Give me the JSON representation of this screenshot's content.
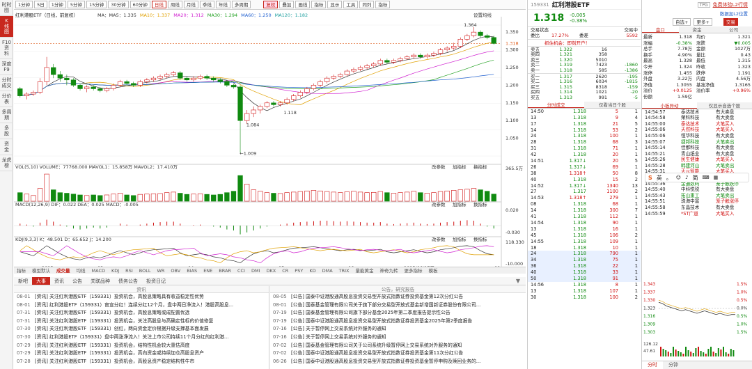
{
  "leftbar": [
    "时时\n图",
    "K\n线\n图",
    "F10\n资\n料",
    "深度\nF9",
    "分时\n成交",
    "分价\n表",
    "多周\n期",
    "多\n股",
    "资\n金",
    "龙虎\n榜"
  ],
  "toolbar": {
    "periods": [
      "1分钟",
      "5日",
      "1分钟",
      "5分钟",
      "15分钟",
      "30分钟",
      "60分钟",
      "日线",
      "周线",
      "月线",
      "季线",
      "年线",
      "多周期"
    ],
    "selected": "日线",
    "tools": [
      "复权",
      "叠加",
      "画线",
      "指标",
      "显示",
      "工具",
      "同列",
      "指标"
    ]
  },
  "chart": {
    "title": "红利港股ETF（日线，前复权）",
    "ma": [
      "MA：MA5：1.335",
      "MA10：1.337",
      "MA20：1.312",
      "MA30：1.294",
      "MA60：1.250",
      "MA120：1.182"
    ],
    "settings": "设置均线",
    "high_label": "1.364",
    "low_label": "1.009",
    "mid_label": "1.084",
    "bottom_label": "1.118",
    "price_ticks": [
      "1.350",
      "1.318",
      "1.300",
      "1.250",
      "1.200",
      "1.150",
      "1.100",
      "1.050"
    ],
    "vol_legend": "VOL(5,10)  VOLUME：77768.000  MAVOL1：15.858万  MAVOL2：17.410万",
    "vol_ticks": [
      "365.5万"
    ],
    "macd_legend": "MACD(12,26,9)  DIF：0.022  DEA：0.025  MACD：-0.005",
    "macd_ticks": [
      "0.020",
      "-0.030"
    ],
    "kdj_legend": "KDJ(9,3,3)  K：48.501  D：65.652  J：14.200",
    "kdj_ticks": [
      "118.330",
      "-10.000"
    ],
    "panel_tools": [
      "改参数",
      "加指标",
      "换指标"
    ],
    "date_labels": [
      "2025",
      "03",
      "04",
      "05",
      "06",
      "2025/06/17三",
      "08"
    ],
    "close_price": 1.318,
    "candles": [
      [
        1.19,
        1.17,
        1.195,
        1.165
      ],
      [
        1.17,
        1.175,
        1.18,
        1.16
      ],
      [
        1.175,
        1.18,
        1.185,
        1.17
      ],
      [
        1.18,
        1.21,
        1.22,
        1.175
      ],
      [
        1.21,
        1.25,
        1.28,
        1.2
      ],
      [
        1.25,
        1.23,
        1.26,
        1.22
      ],
      [
        1.23,
        1.22,
        1.24,
        1.21
      ],
      [
        1.22,
        1.215,
        1.23,
        1.2
      ],
      [
        1.215,
        1.2,
        1.22,
        1.195
      ],
      [
        1.2,
        1.19,
        1.205,
        1.185
      ],
      [
        1.19,
        1.195,
        1.2,
        1.18
      ],
      [
        1.195,
        1.19,
        1.2,
        1.185
      ],
      [
        1.19,
        1.185,
        1.195,
        1.18
      ],
      [
        1.185,
        1.19,
        1.195,
        1.18
      ],
      [
        1.19,
        1.2,
        1.205,
        1.185
      ],
      [
        1.2,
        1.21,
        1.215,
        1.195
      ],
      [
        1.21,
        1.205,
        1.215,
        1.2
      ],
      [
        1.205,
        1.2,
        1.21,
        1.195
      ],
      [
        1.2,
        1.21,
        1.215,
        1.195
      ],
      [
        1.21,
        1.215,
        1.22,
        1.205
      ],
      [
        1.215,
        1.22,
        1.225,
        1.21
      ],
      [
        1.22,
        1.225,
        1.23,
        1.215
      ],
      [
        1.225,
        1.23,
        1.235,
        1.22
      ],
      [
        1.23,
        1.235,
        1.24,
        1.225
      ],
      [
        1.235,
        1.22,
        1.24,
        1.215
      ],
      [
        1.22,
        1.215,
        1.225,
        1.21
      ],
      [
        1.215,
        1.22,
        1.225,
        1.21
      ],
      [
        1.22,
        1.225,
        1.23,
        1.215
      ],
      [
        1.225,
        1.22,
        1.23,
        1.215
      ],
      [
        1.22,
        1.215,
        1.225,
        1.21
      ],
      [
        1.215,
        1.21,
        1.22,
        1.205
      ],
      [
        1.21,
        1.2,
        1.215,
        1.195
      ],
      [
        1.2,
        1.195,
        1.205,
        1.19
      ],
      [
        1.195,
        1.1,
        1.2,
        1.009
      ],
      [
        1.1,
        1.12,
        1.13,
        1.09
      ],
      [
        1.12,
        1.13,
        1.14,
        1.11
      ],
      [
        1.13,
        1.14,
        1.145,
        1.12
      ],
      [
        1.14,
        1.15,
        1.155,
        1.135
      ],
      [
        1.15,
        1.145,
        1.155,
        1.14
      ],
      [
        1.145,
        1.15,
        1.155,
        1.14
      ],
      [
        1.15,
        1.16,
        1.165,
        1.145
      ],
      [
        1.16,
        1.17,
        1.175,
        1.155
      ],
      [
        1.17,
        1.18,
        1.185,
        1.165
      ],
      [
        1.18,
        1.19,
        1.195,
        1.175
      ],
      [
        1.19,
        1.2,
        1.205,
        1.185
      ],
      [
        1.2,
        1.21,
        1.215,
        1.195
      ],
      [
        1.21,
        1.22,
        1.225,
        1.205
      ],
      [
        1.22,
        1.225,
        1.23,
        1.215
      ],
      [
        1.225,
        1.23,
        1.235,
        1.22
      ],
      [
        1.23,
        1.24,
        1.245,
        1.225
      ],
      [
        1.24,
        1.245,
        1.25,
        1.235
      ],
      [
        1.245,
        1.25,
        1.255,
        1.24
      ],
      [
        1.25,
        1.255,
        1.26,
        1.245
      ],
      [
        1.255,
        1.26,
        1.265,
        1.25
      ],
      [
        1.26,
        1.27,
        1.275,
        1.255
      ],
      [
        1.27,
        1.265,
        1.275,
        1.26
      ],
      [
        1.265,
        1.27,
        1.275,
        1.26
      ],
      [
        1.27,
        1.275,
        1.28,
        1.265
      ],
      [
        1.275,
        1.28,
        1.285,
        1.27
      ],
      [
        1.28,
        1.285,
        1.29,
        1.275
      ],
      [
        1.285,
        1.28,
        1.29,
        1.275
      ],
      [
        1.28,
        1.285,
        1.29,
        1.275
      ],
      [
        1.285,
        1.29,
        1.295,
        1.28
      ],
      [
        1.29,
        1.3,
        1.305,
        1.285
      ],
      [
        1.3,
        1.305,
        1.31,
        1.295
      ],
      [
        1.305,
        1.31,
        1.32,
        1.3
      ],
      [
        1.31,
        1.33,
        1.335,
        1.305
      ],
      [
        1.33,
        1.34,
        1.345,
        1.325
      ],
      [
        1.34,
        1.35,
        1.364,
        1.335
      ],
      [
        1.35,
        1.34,
        1.355,
        1.335
      ],
      [
        1.34,
        1.335,
        1.345,
        1.33
      ],
      [
        1.335,
        1.318,
        1.34,
        1.315
      ]
    ],
    "volumes": [
      0.3,
      0.25,
      0.2,
      0.45,
      0.95,
      0.4,
      0.3,
      0.28,
      0.25,
      0.22,
      0.2,
      0.22,
      0.2,
      0.22,
      0.25,
      0.28,
      0.22,
      0.2,
      0.24,
      0.25,
      0.26,
      0.27,
      0.3,
      0.32,
      0.28,
      0.24,
      0.25,
      0.26,
      0.24,
      0.22,
      0.24,
      0.3,
      0.35,
      0.9,
      0.6,
      0.4,
      0.35,
      0.3,
      0.28,
      0.27,
      0.3,
      0.32,
      0.34,
      0.36,
      0.38,
      0.36,
      0.34,
      0.32,
      0.3,
      0.33,
      0.35,
      0.32,
      0.3,
      0.31,
      0.34,
      0.3,
      0.28,
      0.3,
      0.32,
      0.35,
      0.3,
      0.28,
      0.3,
      0.34,
      0.36,
      0.38,
      0.4,
      0.42,
      0.45,
      0.4,
      0.35,
      0.25
    ],
    "macd": [
      0.2,
      0.1,
      -0.1,
      0.3,
      0.6,
      0.4,
      0.1,
      -0.1,
      -0.3,
      -0.4,
      -0.3,
      -0.2,
      -0.3,
      -0.2,
      0,
      0.2,
      0.1,
      0,
      0.1,
      0.2,
      0.3,
      0.35,
      0.4,
      0.4,
      0.2,
      0,
      0.05,
      0.1,
      0,
      -0.1,
      -0.2,
      -0.4,
      -0.5,
      -0.9,
      -0.7,
      -0.5,
      -0.3,
      -0.1,
      0,
      0.1,
      0.2,
      0.3,
      0.35,
      0.4,
      0.45,
      0.5,
      0.5,
      0.45,
      0.4,
      0.45,
      0.4,
      0.35,
      0.3,
      0.3,
      0.35,
      0.2,
      0.15,
      0.2,
      0.25,
      0.3,
      0.2,
      0.15,
      0.2,
      0.3,
      0.35,
      0.4,
      0.5,
      0.55,
      0.5,
      0.2,
      -0.1,
      -0.3
    ],
    "kdj": [
      60,
      50,
      40,
      65,
      90,
      70,
      50,
      35,
      25,
      20,
      30,
      35,
      30,
      40,
      55,
      65,
      55,
      45,
      55,
      65,
      70,
      72,
      75,
      78,
      55,
      40,
      45,
      50,
      45,
      35,
      30,
      20,
      15,
      5,
      30,
      50,
      60,
      65,
      55,
      60,
      70,
      78,
      80,
      82,
      85,
      80,
      75,
      70,
      65,
      70,
      72,
      68,
      65,
      68,
      72,
      60,
      55,
      60,
      65,
      70,
      62,
      55,
      60,
      70,
      75,
      80,
      88,
      90,
      85,
      65,
      50,
      45
    ]
  },
  "bottom_tabs": [
    "指标",
    "模型默认",
    "成交量",
    "均线",
    "MACD",
    "KDJ",
    "RSI",
    "BOLL",
    "WR",
    "OBV",
    "BIAS",
    "ENE",
    "BRAR",
    "CCI",
    "DMI",
    "DKX",
    "CR",
    "PSY",
    "KD",
    "DMA",
    "TRIX",
    "量能黄金",
    "神奇九转",
    "更多指标",
    "模板"
  ],
  "news_tabs": [
    "新吧",
    "大事",
    "资讯",
    "公告",
    "关联品种",
    "债务公告",
    "投资日记"
  ],
  "news_left_header": "资讯",
  "news_left": [
    [
      "08-01",
      "[资讯] 关注红利港股ETF（159331）投资机会，高股息策略具有收益稳定性优势"
    ],
    [
      "08-01",
      "[资讯] 红利港股ETF（159331）官宣分红！连续分红12个月，盘中两日净流入！港股高股息..."
    ],
    [
      "07-31",
      "[资讯] 关注红利港股ETF（159331）投资机会，高股息策略或成配置优选"
    ],
    [
      "07-31",
      "[资讯] 关注红利港股ETF（159331）投资机会，关注高股息与高确定性标的价值修复"
    ],
    [
      "07-30",
      "[资讯] 关注红利港股ETF（159331）创红，两向资金定价根据升级支撑基本面发展"
    ],
    [
      "07-30",
      "[资讯] 红利港股ETF（159331）盘中两涨净流入！关注上市公司持续11个月分红的红利港..."
    ],
    [
      "07-29",
      "[资讯] 关注红利港股ETF（159331）投资机会，结构性机会较大重估高度"
    ],
    [
      "07-29",
      "[资讯] 关注红利港股ETF（159331）投资机会，高向资金或持续加仓高股息资产"
    ],
    [
      "07-28",
      "[资讯] 关注红利港股ETF（159331）投资机会，高股息资产稳定结构性牛市"
    ]
  ],
  "news_right_header": "公告，研究报告",
  "news_right": [
    [
      "08-05",
      "[公告] 国泰中证港股通高股息投资交易型开放式指数证券投资基金第12次分红公告"
    ],
    [
      "08-01",
      "[公告] 国泰基金管理有限公司关于旗下部分交易型开放式基金新增国新证券股份有限公司..."
    ],
    [
      "07-19",
      "[公告] 国泰基金管理有限公司旗下部分基金2025年第二季度报告提示性公告"
    ],
    [
      "07-19",
      "[公告] 国泰中证港股通高股息投资交易型开放式指数证券投资基金2025年第2季度报告"
    ],
    [
      "07-16",
      "[公告] 关于暂停网上交易系统对外服务的通知"
    ],
    [
      "07-16",
      "[公告] 关于暂停网上交易系统对外服务的通知"
    ],
    [
      "07-02",
      "[公告] 国泰基金管理有限公司关于公司系统升级暂停网上交易系统对外服务的通知"
    ],
    [
      "07-02",
      "[公告] 国泰中证港股通高股息投资交易型开放式指数证券投资基金第11次分红公告"
    ],
    [
      "06-26",
      "[公告] 国泰中证港股通高股息投资交易型开放式指数证券投资基金暂停申购及赎回业务的..."
    ]
  ],
  "quote": {
    "code": "159331",
    "name": "红利港股ETF",
    "price": "1.318",
    "change": "-0.005",
    "pct": "-0.38%",
    "buttons": [
      "自选+",
      "更多+"
    ],
    "trade": "交易",
    "top_link": "免费体验L2行情",
    "top_link2": "数据加L2位置",
    "tags": [
      "TPG"
    ]
  },
  "order": {
    "header_left": "交易状态",
    "header_right": "交易中",
    "ratio_label": "委比",
    "ratio": "17.27%",
    "diff_label": "委差",
    "diff": "5592",
    "promo": "抓住机会：即刻开户！",
    "asks": [
      [
        "卖五",
        "1.322",
        "16",
        ""
      ],
      [
        "卖四",
        "1.321",
        "358",
        ""
      ],
      [
        "卖三",
        "1.320",
        "5010",
        ""
      ],
      [
        "卖二",
        "1.319",
        "7423",
        "-1860"
      ],
      [
        "卖一",
        "1.318",
        "585",
        "-1386"
      ]
    ],
    "bids": [
      [
        "买一",
        "1.317",
        "2620",
        "-195"
      ],
      [
        "买二",
        "1.316",
        "6034",
        "-1815"
      ],
      [
        "买三",
        "1.315",
        "8318",
        "-159"
      ],
      [
        "买四",
        "1.314",
        "1021",
        "-20"
      ],
      [
        "买五",
        "1.313",
        "991",
        "-5"
      ]
    ]
  },
  "stats_tabs": [
    "盘口",
    "资金",
    "公司"
  ],
  "stats": [
    [
      "最新",
      "1.318",
      "均价",
      "1.321"
    ],
    [
      "涨幅",
      "-0.38%",
      "涨跌",
      "▼0.005"
    ],
    [
      "总手",
      "7.78万",
      "金额",
      "1027万"
    ],
    [
      "换手",
      "4.90%",
      "量比",
      "0.43"
    ],
    [
      "最高",
      "1.328",
      "最低",
      "1.315"
    ],
    [
      "今开",
      "1.324",
      "昨收",
      "1.323"
    ],
    [
      "涨停",
      "1.455",
      "跌停",
      "1.191"
    ],
    [
      "外盘",
      "3.22万",
      "内盘",
      "4.56万"
    ],
    [
      "净值",
      "1.3055",
      "基准净值",
      "1.3165"
    ],
    [
      "溢价",
      "+0.0125",
      "溢价率",
      "+0.96%"
    ],
    [
      "份额",
      "1.59亿",
      "",
      ""
    ]
  ],
  "tick_tabs": [
    "分时成交",
    "仅看当日个股"
  ],
  "ticks": [
    [
      "14:50",
      "1.318",
      "5",
      "1"
    ],
    [
      "13",
      "1.318",
      "9",
      "4"
    ],
    [
      "17",
      "1.318",
      "21",
      "5"
    ],
    [
      "14",
      "1.318",
      "53",
      "2"
    ],
    [
      "24",
      "1.318",
      "100",
      "1"
    ],
    [
      "28",
      "1.318",
      "68",
      "3"
    ],
    [
      "31",
      "1.318",
      "71",
      "1"
    ],
    [
      "42",
      "1.318",
      "20",
      "1"
    ],
    [
      "14:51",
      "1.317↓",
      "20",
      "5"
    ],
    [
      "26",
      "1.317↓",
      "69",
      "1"
    ],
    [
      "38",
      "1.318↑",
      "50",
      "8"
    ],
    [
      "40",
      "1.318",
      "15",
      "2"
    ],
    [
      "14:52",
      "1.317↓",
      "1340",
      "13"
    ],
    [
      "27",
      "1.317",
      "1100",
      "2"
    ],
    [
      "14:53",
      "1.318↑",
      "279",
      "1"
    ],
    [
      "08",
      "1.318",
      "68",
      "1"
    ],
    [
      "14",
      "1.318",
      "300",
      "7"
    ],
    [
      "41",
      "1.318",
      "112",
      "1"
    ],
    [
      "14:54",
      "1.318",
      "90",
      "1"
    ],
    [
      "13",
      "1.318",
      "16",
      "1"
    ],
    [
      "45",
      "1.318",
      "106",
      "2"
    ],
    [
      "14:55",
      "1.318",
      "109",
      "1"
    ],
    [
      "18",
      "1.318",
      "10",
      "1"
    ],
    [
      "24",
      "1.318",
      "790",
      "1"
    ],
    [
      "34",
      "1.318",
      "75",
      "1"
    ],
    [
      "36",
      "1.318",
      "22",
      "1"
    ],
    [
      "40",
      "1.318",
      "33",
      "1"
    ],
    [
      "50",
      "1.318",
      "91",
      "1"
    ],
    [
      "14:56",
      "1.318",
      "8",
      "1"
    ],
    [
      "13",
      "1.318",
      "107",
      "1"
    ],
    [
      "30",
      "1.318",
      "100",
      "2"
    ]
  ],
  "market_tabs": [
    "小板异动",
    "仅显示自选个股"
  ],
  "market": [
    [
      "14:54:57",
      "泰达技术",
      "有大卖盘"
    ],
    [
      "14:54:58",
      "荣科科技",
      "有大卖盘"
    ],
    [
      "14:55:00",
      "泰达技术",
      "大笔买入"
    ],
    [
      "14:55:06",
      "天然科技",
      "大笔买入"
    ],
    [
      "14:55:06",
      "恒华科技",
      "有大卖盘"
    ],
    [
      "14:55:07",
      "捷邦科技",
      "大笔卖出"
    ],
    [
      "14:55:14",
      "佳都科技",
      "有大卖盘"
    ],
    [
      "14:55:21",
      "青山纸业",
      "有大卖盘"
    ],
    [
      "14:55:26",
      "民生健康",
      "大笔买入"
    ],
    [
      "14:55:28",
      "韩建河山",
      "大笔卖出"
    ],
    [
      "14:55:31",
      "天元智能",
      "大笔买入"
    ],
    [
      "14:55:32",
      "江波龙",
      "有大买盘"
    ],
    [
      "14:55:36",
      "金通数码",
      "笼子触跌停"
    ],
    [
      "14:55:40",
      "中科悦锐",
      "有大卖盘"
    ],
    [
      "14:55:43",
      "拓山重工",
      "大笔卖出"
    ],
    [
      "14:55:51",
      "珠海中富",
      "笼子触涨停"
    ],
    [
      "14:55:58",
      "东晶技术",
      "有大卖盘"
    ],
    [
      "14:55:59",
      "*ST广道",
      "大笔买入"
    ]
  ],
  "mini": {
    "ticks_left": [
      "1.343",
      "1.337",
      "1.330",
      "1.323",
      "1.316",
      "1.309",
      "1.303"
    ],
    "ticks_right": [
      "1.5%",
      "1.0%",
      "0.5%",
      "0.0%",
      "0.5%",
      "1.0%",
      "1.5%"
    ],
    "vol_labels": [
      "126.12",
      "47.61"
    ],
    "tabs": [
      "分时",
      "分钟"
    ],
    "series": [
      1.328,
      1.327,
      1.325,
      1.324,
      1.323,
      1.322,
      1.321,
      1.322,
      1.321,
      1.32,
      1.319,
      1.32,
      1.321,
      1.32,
      1.319,
      1.318,
      1.319,
      1.318,
      1.317,
      1.318,
      1.318
    ]
  },
  "ime": [
    "英",
    "。",
    "简"
  ]
}
